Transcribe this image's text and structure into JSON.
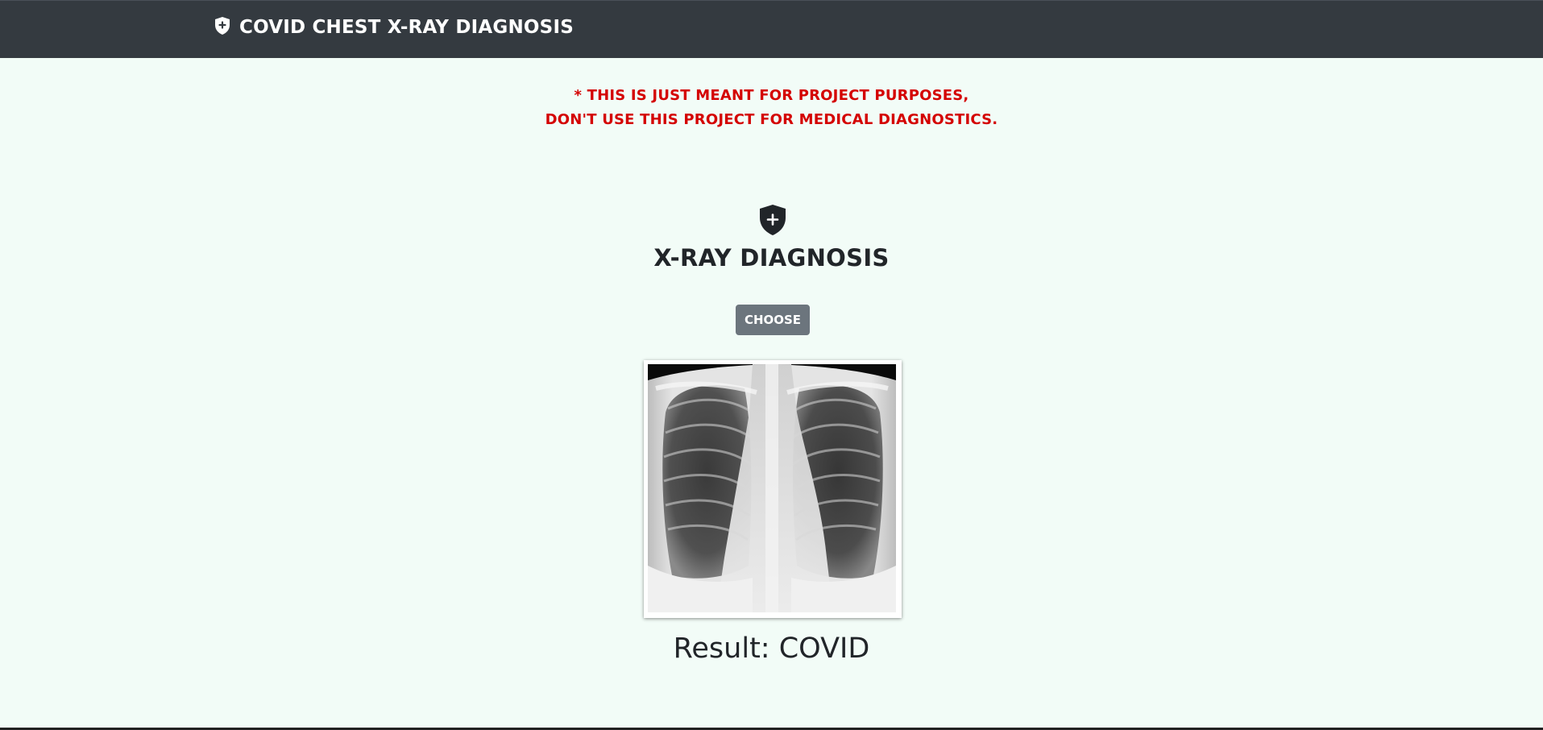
{
  "navbar": {
    "brand_icon": "shield-plus-icon",
    "brand_text": "COVID CHEST X-RAY DIAGNOSIS"
  },
  "disclaimer": {
    "line1": "* THIS IS JUST MEANT FOR PROJECT PURPOSES,",
    "line2": "DON'T USE THIS PROJECT FOR MEDICAL DIAGNOSTICS."
  },
  "main": {
    "icon": "shield-plus-icon",
    "title": "X-RAY DIAGNOSIS",
    "choose_label": "CHOOSE",
    "image_alt": "chest x-ray image",
    "result_label": "Result:",
    "result_value": "COVID"
  },
  "colors": {
    "navbar_bg": "#343a40",
    "page_bg": "#f2fcf7",
    "disclaimer": "#d40000",
    "button_bg": "#6c757d",
    "text": "#212529"
  }
}
